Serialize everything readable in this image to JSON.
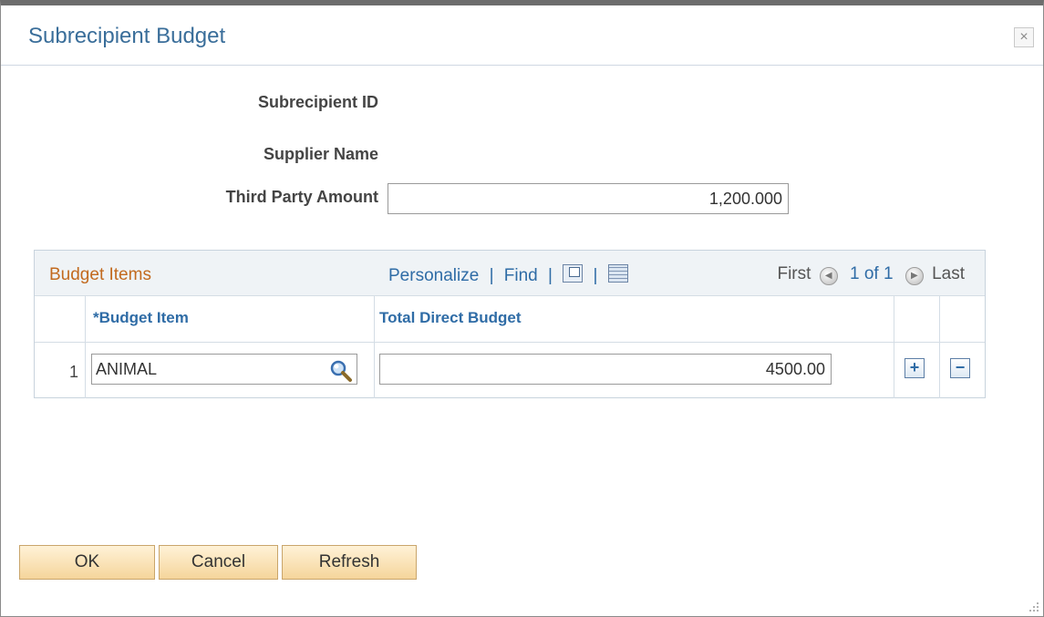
{
  "dialog": {
    "title": "Subrecipient Budget",
    "close_glyph": "×"
  },
  "form": {
    "subrecipient_id_label": "Subrecipient ID",
    "supplier_name_label": "Supplier Name",
    "third_party_amount_label": "Third Party Amount",
    "third_party_amount_value": "1,200.000"
  },
  "grid": {
    "title": "Budget Items",
    "nav": {
      "personalize": "Personalize",
      "separator": "|",
      "find": "Find",
      "zoom_icon": "view-all-icon",
      "download_icon": "download-to-spreadsheet-icon"
    },
    "pager": {
      "first": "First",
      "count": "1 of 1",
      "last": "Last",
      "prev_glyph": "◀",
      "next_glyph": "▶"
    },
    "columns": [
      "*Budget Item",
      "Total Direct Budget"
    ],
    "rows": [
      {
        "num": "1",
        "budget_item": "ANIMAL",
        "total_direct_budget": "4500.00"
      }
    ],
    "add_glyph": "+",
    "delete_glyph": "−"
  },
  "buttons": {
    "ok": "OK",
    "cancel": "Cancel",
    "refresh": "Refresh"
  },
  "colors": {
    "title": "#3a6e9a",
    "grid_title": "#c26a1e",
    "link": "#2f6ca6",
    "button_fill": "#f5d59b"
  }
}
